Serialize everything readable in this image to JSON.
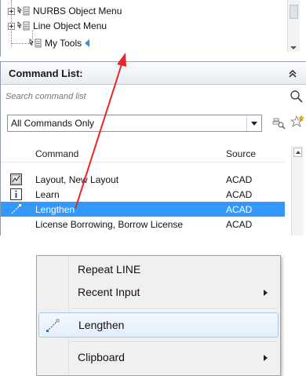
{
  "tree": {
    "items": [
      {
        "label": "NURBS Object Menu"
      },
      {
        "label": "Line Object Menu"
      },
      {
        "label": "My Tools"
      }
    ]
  },
  "command_list": {
    "title": "Command List:",
    "search_placeholder": "Search command list",
    "filter_value": "All Commands Only",
    "columns": {
      "command": "Command",
      "source": "Source"
    },
    "rows": [
      {
        "icon": "layout-icon",
        "command": "Layout, New Layout",
        "source": "ACAD"
      },
      {
        "icon": "info-icon",
        "command": "Learn",
        "source": "ACAD"
      },
      {
        "icon": "lengthen-icon",
        "command": "Lengthen",
        "source": "ACAD",
        "selected": true
      },
      {
        "icon": "",
        "command": "License Borrowing, Borrow License",
        "source": "ACAD"
      }
    ]
  },
  "context_menu": {
    "items": [
      {
        "label": "Repeat LINE",
        "submenu": false
      },
      {
        "label": "Recent Input",
        "submenu": true
      },
      {
        "label": "Lengthen",
        "submenu": false,
        "highlighted": true,
        "icon": "lengthen-icon"
      },
      {
        "label": "Clipboard",
        "submenu": true
      }
    ]
  },
  "colors": {
    "selection": "#3399ff",
    "drag_arrow": "#e8262a"
  }
}
